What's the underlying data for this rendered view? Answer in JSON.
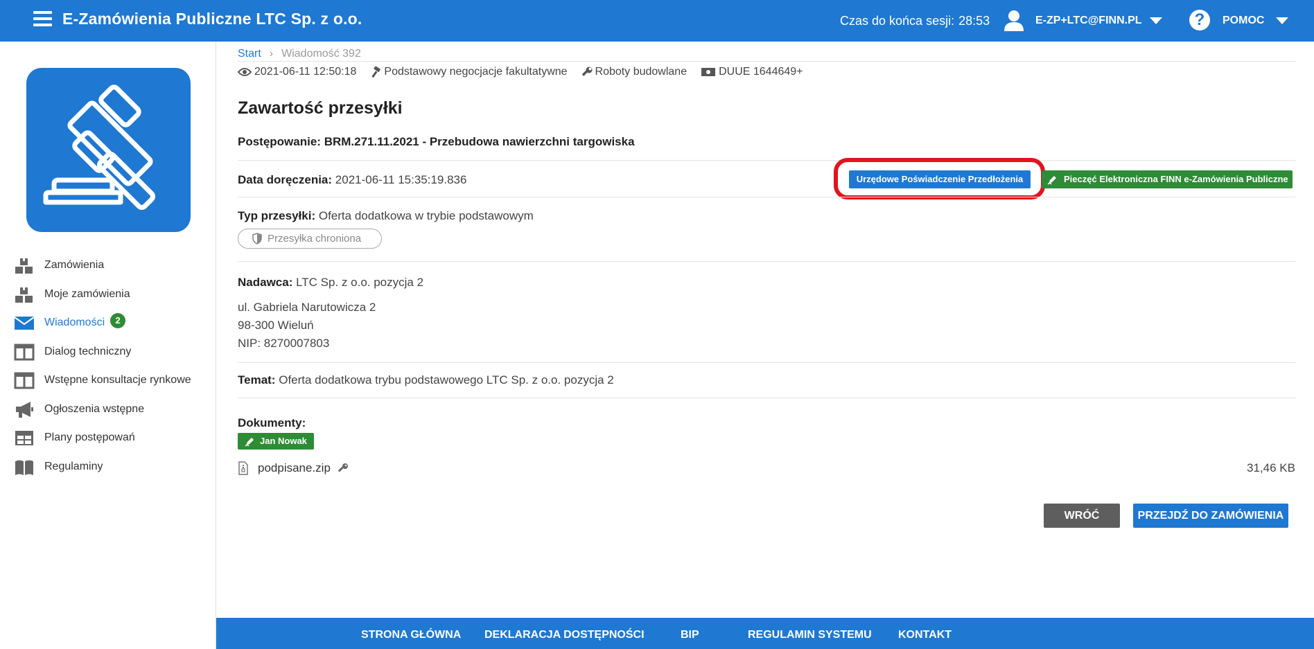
{
  "header": {
    "app_title": "E-Zamówienia Publiczne LTC Sp. z o.o.",
    "session_label": "Czas do końca sesji:",
    "session_timer": "28:53",
    "user_email": "E-ZP+LTC@FINN.PL",
    "help_label": "POMOC"
  },
  "sidebar": {
    "items": [
      {
        "label": "Zamówienia",
        "icon": "boxes-icon"
      },
      {
        "label": "Moje zamówienia",
        "icon": "boxes-icon"
      },
      {
        "label": "Wiadomości",
        "icon": "envelope-icon",
        "badge": "2",
        "active": true
      },
      {
        "label": "Dialog techniczny",
        "icon": "columns-icon"
      },
      {
        "label": "Wstępne konsultacje rynkowe",
        "icon": "columns-icon"
      },
      {
        "label": "Ogłoszenia wstępne",
        "icon": "megaphone-icon"
      },
      {
        "label": "Plany postępowań",
        "icon": "table-icon"
      },
      {
        "label": "Regulaminy",
        "icon": "book-icon"
      }
    ]
  },
  "breadcrumb": {
    "start": "Start",
    "separator": "›",
    "current": "Wiadomość 392"
  },
  "meta": {
    "date": "2021-06-11 12:50:18",
    "mode": "Podstawowy negocjacje fakultatywne",
    "type": "Roboty budowlane",
    "duue": "DUUE 1644649+"
  },
  "title": "Zawartość przesyłki",
  "procedure": {
    "label": "Postępowanie:",
    "value": "BRM.271.11.2021 - Przebudowa nawierzchni targowiska"
  },
  "delivery": {
    "label": "Data doręczenia:",
    "value": "2021-06-11 15:35:19.836"
  },
  "buttons": {
    "certificate": "Urzędowe Poświadczenie Przedłożenia",
    "seal": "Pieczęć Elektroniczna FINN e-Zamówienia Publiczne",
    "back": "WRÓĆ",
    "goto_order": "PRZEJDŹ DO ZAMÓWIENIA"
  },
  "shipment_type": {
    "label": "Typ przesyłki:",
    "value": "Oferta dodatkowa w trybie podstawowym",
    "protected_label": "Przesyłka chroniona"
  },
  "sender": {
    "label": "Nadawca:",
    "name": "LTC Sp. z o.o. pozycja 2",
    "street": "ul. Gabriela Narutowicza 2",
    "city": "98-300 Wieluń",
    "nip": "NIP: 8270007803"
  },
  "subject": {
    "label": "Temat:",
    "value": "Oferta dodatkowa trybu podstawowego LTC Sp. z o.o. pozycja 2"
  },
  "documents": {
    "label": "Dokumenty:",
    "signer": "Jan Nowak",
    "file_name": "podpisane.zip",
    "file_size": "31,46 KB"
  },
  "footer": {
    "links": [
      "STRONA GŁÓWNA",
      "DEKLARACJA DOSTĘPNOŚCI",
      "BIP",
      "REGULAMIN SYSTEMU",
      "KONTAKT"
    ]
  },
  "colors": {
    "primary": "#1f78d1",
    "success": "#2e8b36",
    "highlight": "#e1141e",
    "neutral_button": "#5e5e5e"
  }
}
